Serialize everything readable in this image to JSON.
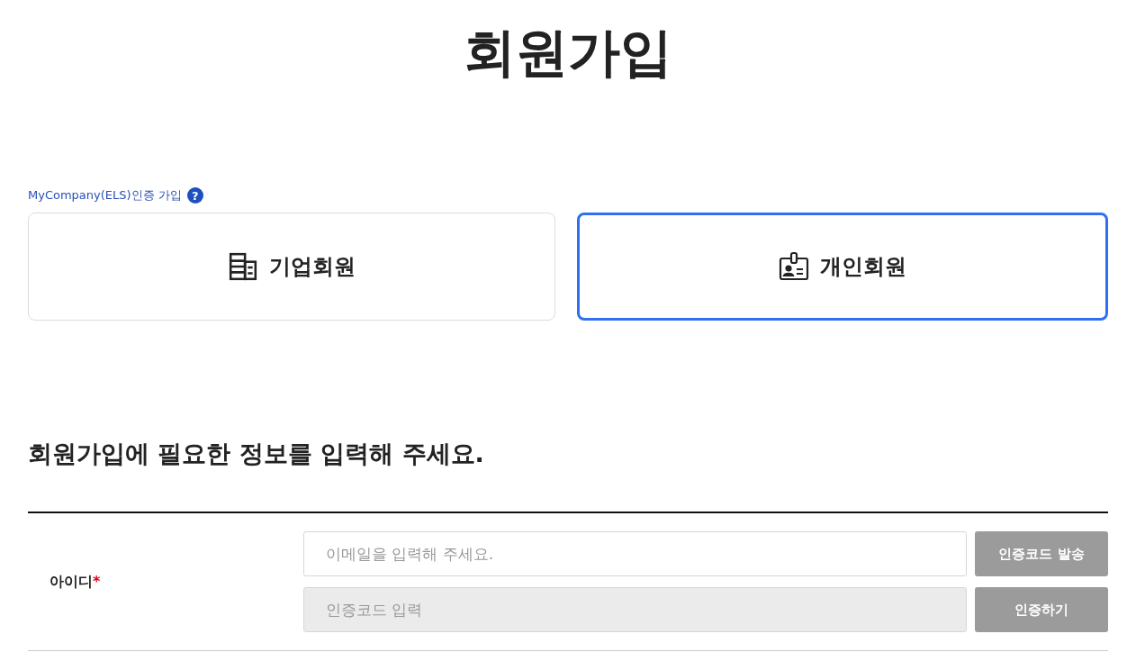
{
  "title": "회원가입",
  "auth_label": {
    "text": "MyCompany(ELS)인증 가입",
    "help": "?"
  },
  "member_types": [
    {
      "kind": "company",
      "label": "기업회원",
      "selected": false
    },
    {
      "kind": "personal",
      "label": "개인회원",
      "selected": true
    }
  ],
  "section_heading": "회원가입에 필요한 정보를 입력해 주세요.",
  "form_rows": [
    {
      "label": "아이디",
      "required_mark": "*",
      "fields": [
        {
          "placeholder": "이메일을 입력해 주세요.",
          "disabled": false,
          "button": "인증코드 발송"
        },
        {
          "placeholder": "인증코드 입력",
          "disabled": true,
          "button": "인증하기"
        }
      ]
    }
  ]
}
